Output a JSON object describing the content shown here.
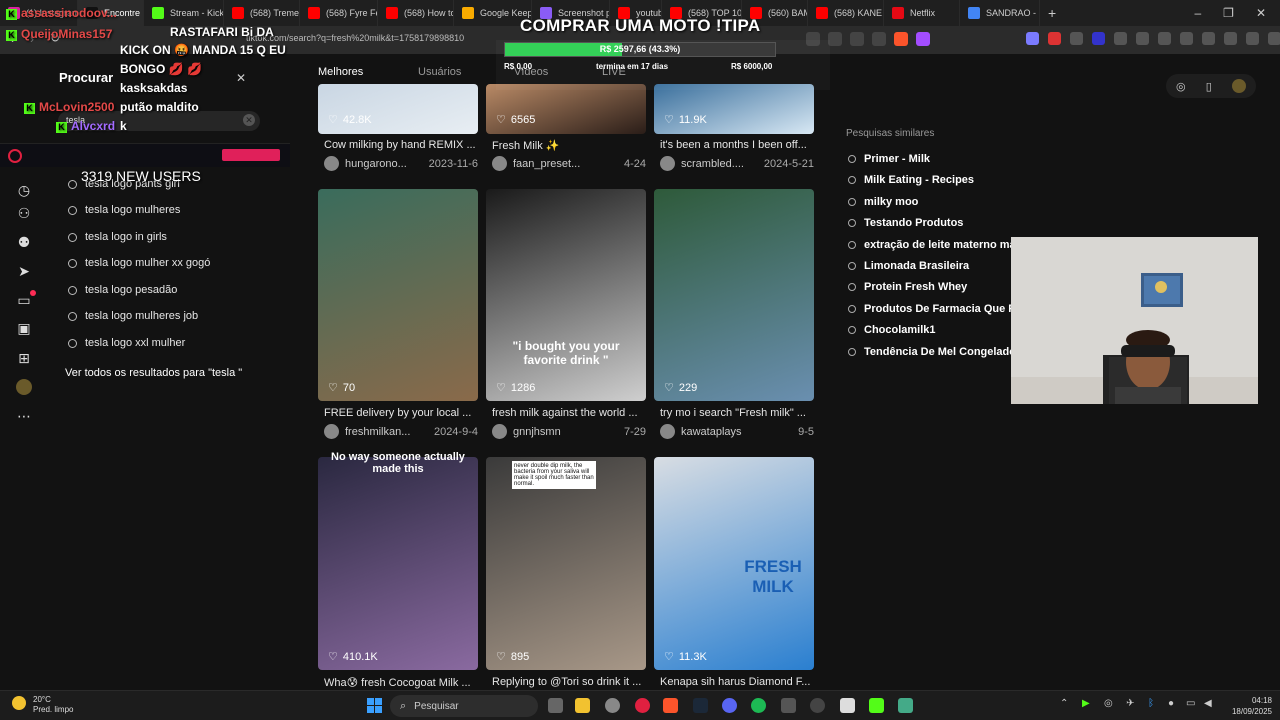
{
  "browser": {
    "tabs": [
      {
        "label": "(1) Instagram",
        "color": "#d6249f"
      },
      {
        "label": "Encontre",
        "color": "#111111",
        "active": true
      },
      {
        "label": "Stream - Kick",
        "color": "#53fc18"
      },
      {
        "label": "(568) Tremen",
        "color": "#ff0000"
      },
      {
        "label": "(568) Fyre Fe",
        "color": "#ff0000"
      },
      {
        "label": "(568) How to",
        "color": "#ff0000"
      },
      {
        "label": "Google Keep",
        "color": "#f9ab00"
      },
      {
        "label": "Screenshot p",
        "color": "#8a5cf6"
      },
      {
        "label": "youtube",
        "color": "#ff0000"
      },
      {
        "label": "(568) TOP 10",
        "color": "#ff0000"
      },
      {
        "label": "(560) BAMF",
        "color": "#ff0000"
      },
      {
        "label": "(568) KANE E",
        "color": "#ff0000"
      },
      {
        "label": "Netflix",
        "color": "#e50914"
      },
      {
        "label": "SANDRAO -",
        "color": "#4285f4"
      }
    ],
    "new_tab": "+",
    "window_controls": [
      "–",
      "❐",
      "✕"
    ],
    "url": "tiktok.com/search?q=fresh%20milk&t=1758179898810"
  },
  "stream_overlay": {
    "goal_title": "COMPRAR UMA MOTO !TIPA",
    "goal_progress_text": "R$ 2597,66 (43.3%)",
    "goal_progress_fraction": 0.433,
    "goal_start": "R$ 0,00",
    "goal_remaining": "termina em 17 dias",
    "goal_target": "R$ 6000,00",
    "new_users": "3319 NEW USERS",
    "chat": [
      {
        "user": "assassinodoov...",
        "message": "RASTAFARI Bi DA"
      },
      {
        "user": "QueijoMinas157",
        "message": "KICK ON 🤬 MANDA 15 Q EU"
      },
      {
        "user": "",
        "message": "BONGO 💋 💋"
      },
      {
        "user": "",
        "message": "kasksakdas"
      },
      {
        "user": "McLovin2500",
        "message": "putão maldito"
      },
      {
        "user": "Alvcxrd",
        "message": "k"
      }
    ]
  },
  "tiktok": {
    "search_title": "Procurar",
    "search_query": "tesla",
    "suggestions": [
      "tesla logo pants girl",
      "tesla logo mulheres",
      "tesla logo in girls",
      "tesla logo mulher xx gogó",
      "tesla logo pesadão",
      "tesla logo mulheres job",
      "tesla logo xxl mulher"
    ],
    "view_all": "Ver todos os resultados para \"tesla \"",
    "tabs": [
      "Melhores",
      "Usuários",
      "Vídeos",
      "LIVE"
    ],
    "similar_title": "Pesquisas similares",
    "similar": [
      "Primer - Milk",
      "Milk Eating - Recipes",
      "milky moo",
      "Testando Produtos",
      "extração de leite materno manual",
      "Limonada Brasileira",
      "Protein Fresh Whey",
      "Produtos De Farmacia Que Funcionam",
      "Chocolamilk1",
      "Tendência De Mel Congelado"
    ],
    "videos": [
      {
        "likes": "42.8K",
        "caption": "Cow milking by hand REMIX ...",
        "author": "hungarono...",
        "date": "2023-11-6",
        "overlay": ""
      },
      {
        "likes": "6565",
        "caption": "Fresh Milk ✨",
        "author": "faan_preset...",
        "date": "4-24",
        "overlay": ""
      },
      {
        "likes": "11.9K",
        "caption": "it's been a months I been off...",
        "author": "scrambled....",
        "date": "2024-5-21",
        "overlay": ""
      },
      {
        "likes": "70",
        "caption": "FREE delivery by your local ...",
        "author": "freshmilkan...",
        "date": "2024-9-4",
        "overlay": ""
      },
      {
        "likes": "1286",
        "caption": "fresh milk against the world ...",
        "author": "gnnjhsmn",
        "date": "7-29",
        "overlay": "\"i bought you your favorite drink \""
      },
      {
        "likes": "229",
        "caption": "try mo i search \"Fresh milk\" ...",
        "author": "kawataplays",
        "date": "9-5",
        "overlay": ""
      },
      {
        "likes": "410.1K",
        "caption": "Wha😰 fresh Cocogoat Milk ...",
        "author": "",
        "date": "",
        "overlay": "No way someone actually made this"
      },
      {
        "likes": "895",
        "caption": "Replying to @Tori so drink it ...",
        "author": "",
        "date": "",
        "overlay": "never double dip milk, the bacteria from your saliva will make it spoil much faster than normal."
      },
      {
        "likes": "11.3K",
        "caption": "Kenapa sih harus Diamond F...",
        "author": "",
        "date": "",
        "overlay": "FRESH MILK"
      }
    ]
  },
  "taskbar": {
    "weather_temp": "20°C",
    "weather_desc": "Pred. limpo",
    "search_placeholder": "Pesquisar",
    "time": "04:18",
    "date": "18/09/2025"
  }
}
